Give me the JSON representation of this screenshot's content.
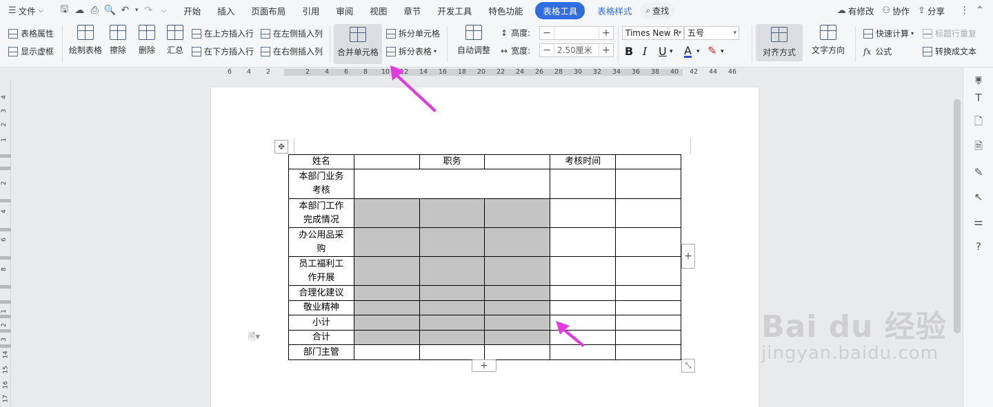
{
  "menubar": {
    "file_label": "文件",
    "tabs": [
      "开始",
      "插入",
      "页面布局",
      "引用",
      "审阅",
      "视图",
      "章节",
      "开发工具",
      "特色功能"
    ],
    "active_tab": "表格工具",
    "style_tab": "表格样式",
    "search_label": "查找",
    "right": {
      "modified": "有修改",
      "collab": "协作",
      "share": "分享"
    }
  },
  "ribbon": {
    "table_props": "表格属性",
    "show_gridlines": "显示虚框",
    "draw_table": "绘制表格",
    "erase": "擦除",
    "delete": "删除",
    "summarize": "汇总",
    "insert_above": "在上方插入行",
    "insert_below": "在下方插入行",
    "insert_left": "在左侧插入列",
    "insert_right": "在右侧插入列",
    "merge_cells": "合并单元格",
    "split_cells": "拆分单元格",
    "split_table": "拆分表格",
    "auto_adjust": "自动调整",
    "height_label": "高度:",
    "height_value": "",
    "width_label": "宽度:",
    "width_value": "2.50厘米",
    "font_name": "Times New R",
    "font_size": "五号",
    "align": "对齐方式",
    "text_dir": "文字方向",
    "quick_calc": "快速计算",
    "formula": "公式",
    "repeat_header": "标题行重复",
    "to_text": "转换成文本"
  },
  "ruler": {
    "ticks": [
      "6",
      "4",
      "2",
      "2",
      "4",
      "6",
      "8",
      "10",
      "12",
      "14",
      "16",
      "18",
      "20",
      "22",
      "24",
      "26",
      "28",
      "30",
      "32",
      "34",
      "36",
      "38",
      "40",
      "42",
      "44",
      "46"
    ],
    "vticks": [
      "4",
      "3",
      "2",
      "1",
      "2",
      "4",
      "6",
      "8",
      "1",
      "2",
      "3",
      "14",
      "15",
      "16",
      "17"
    ]
  },
  "table": {
    "header": [
      "姓名",
      "",
      "职务",
      "",
      "考核时间",
      ""
    ],
    "rows": [
      {
        "label": "本部门业务考核",
        "label_lines": [
          "本部门业务",
          "考核"
        ]
      },
      {
        "label": "本部门工作完成情况",
        "label_lines": [
          "本部门工作",
          "完成情况"
        ]
      },
      {
        "label": "办公用品采购",
        "label_lines": [
          "办公用品采",
          "购"
        ]
      },
      {
        "label": "员工福利工作开展",
        "label_lines": [
          "员工福利工",
          "作开展"
        ]
      },
      {
        "label": "合理化建议",
        "label_lines": [
          "合理化建议"
        ]
      },
      {
        "label": "敬业精神",
        "label_lines": [
          "敬业精神"
        ]
      },
      {
        "label": "小计",
        "label_lines": [
          "小计"
        ]
      },
      {
        "label": "合计",
        "label_lines": [
          "合计"
        ]
      },
      {
        "label": "部门主管",
        "label_lines": [
          "部门主管"
        ]
      }
    ],
    "shade_color": "#c4c4c4"
  },
  "watermark": {
    "line1": "Bai du 经验",
    "line2": "jingyan.baidu.com"
  },
  "colors": {
    "accent": "#2f6de1",
    "arrow": "#e33ae0"
  }
}
